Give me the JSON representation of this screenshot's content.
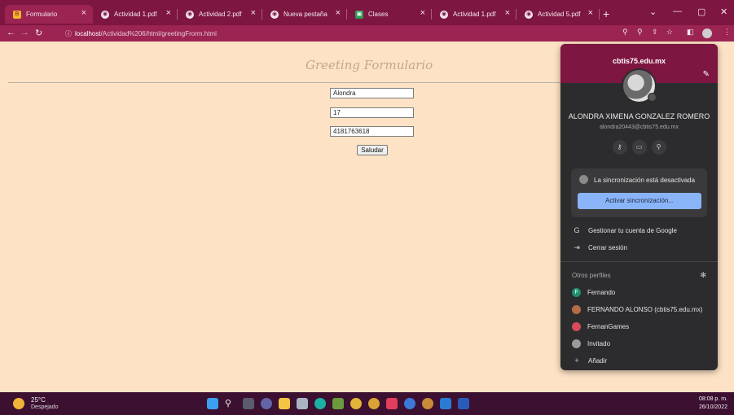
{
  "tabs": [
    {
      "label": "Formulario",
      "favicon": "blogger-square-icon",
      "active": true
    },
    {
      "label": "Actividad 1.pdf",
      "favicon": "chrome-globe-icon",
      "active": false
    },
    {
      "label": "Actividad 2.pdf",
      "favicon": "chrome-globe-icon",
      "active": false
    },
    {
      "label": "Nueva pestaña",
      "favicon": "chrome-globe-icon",
      "active": false
    },
    {
      "label": "Clases",
      "favicon": "classroom-icon",
      "active": false
    },
    {
      "label": "Actividad 1.pdf",
      "favicon": "chrome-globe-icon",
      "active": false
    },
    {
      "label": "Actividad 5.pdf",
      "favicon": "chrome-globe-icon",
      "active": false
    }
  ],
  "toolbar": {
    "url_host": "localhost",
    "url_path": "/Actividad%206/html/greetingFrorm.html"
  },
  "page": {
    "title": "Greeting Formulario",
    "field_name": "Alondra",
    "field_age": "17",
    "field_phone": "4181763618",
    "submit_label": "Saludar"
  },
  "profile": {
    "domain": "cbtis75.edu.mx",
    "name": "ALONDRA XIMENA GONZALEZ ROMERO",
    "email": "alondra20443@cbtis75.edu.mx",
    "sync_status": "La sincronización está desactivada",
    "sync_button": "Activar sincronización...",
    "manage_account": "Gestionar tu cuenta de Google",
    "sign_out": "Cerrar sesión",
    "other_profiles_label": "Otros perfiles",
    "other_profiles": [
      {
        "name": "Fernando",
        "initial": "F",
        "color": "#1e8e6e"
      },
      {
        "name": "FERNANDO ALONSO (cbtis75.edu.mx)",
        "initial": "",
        "color": "#b86a44"
      },
      {
        "name": "FernanGames",
        "initial": "",
        "color": "#d64a5a"
      },
      {
        "name": "Invitado",
        "initial": "",
        "color": "#9a9a9a"
      }
    ],
    "add_label": "Añadir"
  },
  "taskbar": {
    "temperature": "25°C",
    "condition": "Despejado",
    "time": "08:08 p. m.",
    "date": "26/10/2022"
  },
  "colors": {
    "chrome_frame": "#7d1640",
    "page_background": "#fde2c5",
    "sync_button": "#8ab4f8"
  }
}
